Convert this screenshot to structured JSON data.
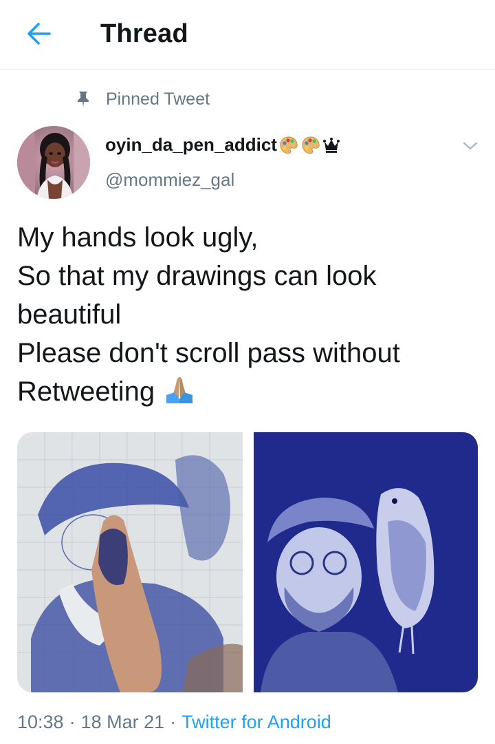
{
  "header": {
    "title": "Thread",
    "back_icon": "arrow-left-icon",
    "accent_color": "#1da1f2"
  },
  "pinned": {
    "label": "Pinned Tweet",
    "icon": "pin-icon"
  },
  "tweet": {
    "author": {
      "display_name": "oyin_da_pen_addict",
      "display_name_emojis": [
        "palette-emoji",
        "palette-emoji",
        "crown-emoji"
      ],
      "handle": "@mommiez_gal"
    },
    "text_lines": [
      "My hands look ugly,",
      "So that my drawings can look",
      "beautiful",
      "Please don't scroll pass without",
      "Retweeting"
    ],
    "text_trailing_emoji": "praying-hands-emoji",
    "media": [
      {
        "name": "finger-over-drawing-photo"
      },
      {
        "name": "finished-ballpoint-portrait-photo"
      }
    ],
    "time": "10:38",
    "date": "18 Mar 21",
    "separator": "·",
    "source": "Twitter for Android"
  },
  "colors": {
    "text_primary": "#14171a",
    "text_secondary": "#657786",
    "link": "#1da1f2",
    "divider": "#e1e8ed"
  }
}
